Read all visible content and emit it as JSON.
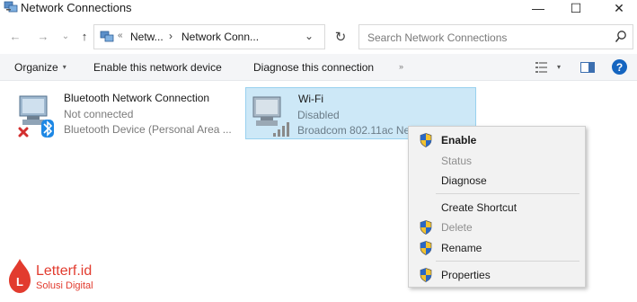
{
  "window": {
    "title": "Network Connections",
    "controls": {
      "minimize": "—",
      "maximize": "☐",
      "close": "✕"
    }
  },
  "address_bar": {
    "crumb_root_sep": "«",
    "crumb_1": "Netw...",
    "crumb_sep": "›",
    "crumb_2": "Network Conn...",
    "dropdown": "⌄",
    "refresh": "↻"
  },
  "search": {
    "placeholder": "Search Network Connections"
  },
  "command_bar": {
    "organize": "Organize",
    "organize_caret": "▾",
    "enable_device": "Enable this network device",
    "diagnose": "Diagnose this connection",
    "more": "»"
  },
  "connections": [
    {
      "name": "Bluetooth Network Connection",
      "status": "Not connected",
      "device": "Bluetooth Device (Personal Area ..."
    },
    {
      "name": "Wi-Fi",
      "status": "Disabled",
      "device": "Broadcom 802.11ac Ne..."
    }
  ],
  "context_menu": {
    "items": [
      {
        "label": "Enable",
        "icon": "shield-icon",
        "bold": true,
        "disabled": false
      },
      {
        "label": "Status",
        "icon": "",
        "bold": false,
        "disabled": true
      },
      {
        "label": "Diagnose",
        "icon": "",
        "bold": false,
        "disabled": false
      },
      {
        "label": "Create Shortcut",
        "icon": "",
        "bold": false,
        "disabled": false
      },
      {
        "label": "Delete",
        "icon": "shield-icon",
        "bold": false,
        "disabled": true
      },
      {
        "label": "Rename",
        "icon": "shield-icon",
        "bold": false,
        "disabled": false
      },
      {
        "label": "Properties",
        "icon": "shield-icon",
        "bold": false,
        "disabled": false
      }
    ]
  },
  "watermark": {
    "name": "Letterf.id",
    "tagline": "Solusi Digital"
  },
  "colors": {
    "selection_bg": "#cde8f7",
    "selection_border": "#99d1ef",
    "help_blue": "#1565c0",
    "watermark_red": "#e23b2e",
    "error_red": "#d32f2f",
    "bluetooth_blue": "#1e88e5"
  }
}
